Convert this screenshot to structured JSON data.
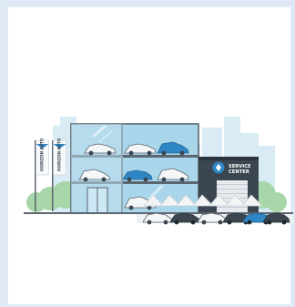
{
  "scene": {
    "subject": "car-dealership-illustration",
    "palette": {
      "background": "#dfe9f6",
      "card": "#ffffff",
      "skyline": "#d9ebf4",
      "glass": "#a9d6ea",
      "glass_light": "#cce8f4",
      "frame": "#5c6670",
      "dark_panel": "#3b4650",
      "accent_blue": "#2f86c5",
      "tree": "#a7d7a8",
      "ground": "#eef1f4"
    }
  },
  "flags": [
    {
      "text": "HORIZON AUTO"
    },
    {
      "text": "HORIZON AUTO"
    }
  ],
  "service_sign": {
    "line1": "SERVICE",
    "line2": "CENTER"
  }
}
